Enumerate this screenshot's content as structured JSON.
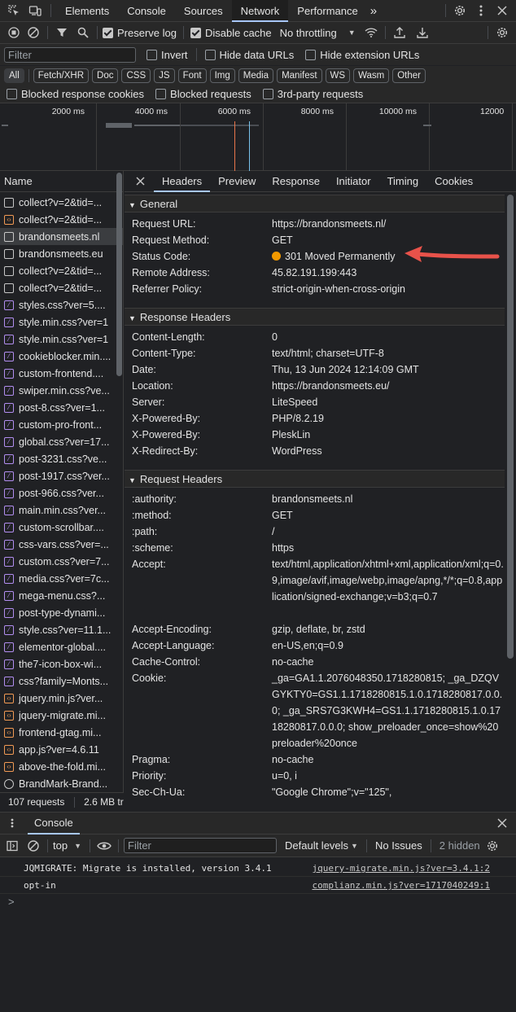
{
  "topbar": {
    "tabs": [
      "Elements",
      "Console",
      "Sources",
      "Network",
      "Performance"
    ],
    "active": "Network",
    "more": "»"
  },
  "toolbar": {
    "preserve_log": "Preserve log",
    "disable_cache": "Disable cache",
    "throttling": "No throttling"
  },
  "filter": {
    "placeholder": "Filter",
    "invert": "Invert",
    "hide_data_urls": "Hide data URLs",
    "hide_ext_urls": "Hide extension URLs"
  },
  "types": [
    "All",
    "Fetch/XHR",
    "Doc",
    "CSS",
    "JS",
    "Font",
    "Img",
    "Media",
    "Manifest",
    "WS",
    "Wasm",
    "Other"
  ],
  "blocked": {
    "blocked_cookies": "Blocked response cookies",
    "blocked_requests": "Blocked requests",
    "third_party": "3rd-party requests"
  },
  "overview": {
    "ticks": [
      "2000 ms",
      "4000 ms",
      "6000 ms",
      "8000 ms",
      "10000 ms",
      "12000"
    ]
  },
  "list": {
    "header": "Name",
    "items": [
      {
        "name": "collect?v=2&tid=...",
        "type": "doc"
      },
      {
        "name": "collect?v=2&tid=...",
        "type": "fetch"
      },
      {
        "name": "brandonsmeets.nl",
        "type": "doc",
        "selected": true
      },
      {
        "name": "brandonsmeets.eu",
        "type": "doc"
      },
      {
        "name": "collect?v=2&tid=...",
        "type": "doc"
      },
      {
        "name": "collect?v=2&tid=...",
        "type": "doc"
      },
      {
        "name": "styles.css?ver=5....",
        "type": "css"
      },
      {
        "name": "style.min.css?ver=1",
        "type": "css"
      },
      {
        "name": "style.min.css?ver=1",
        "type": "css"
      },
      {
        "name": "cookieblocker.min....",
        "type": "css"
      },
      {
        "name": "custom-frontend....",
        "type": "css"
      },
      {
        "name": "swiper.min.css?ve...",
        "type": "css"
      },
      {
        "name": "post-8.css?ver=1...",
        "type": "css"
      },
      {
        "name": "custom-pro-front...",
        "type": "css"
      },
      {
        "name": "global.css?ver=17...",
        "type": "css"
      },
      {
        "name": "post-3231.css?ve...",
        "type": "css"
      },
      {
        "name": "post-1917.css?ver...",
        "type": "css"
      },
      {
        "name": "post-966.css?ver...",
        "type": "css"
      },
      {
        "name": "main.min.css?ver...",
        "type": "css"
      },
      {
        "name": "custom-scrollbar....",
        "type": "css"
      },
      {
        "name": "css-vars.css?ver=...",
        "type": "css"
      },
      {
        "name": "custom.css?ver=7...",
        "type": "css"
      },
      {
        "name": "media.css?ver=7c...",
        "type": "css"
      },
      {
        "name": "mega-menu.css?...",
        "type": "css"
      },
      {
        "name": "post-type-dynami...",
        "type": "css"
      },
      {
        "name": "style.css?ver=11.1...",
        "type": "css"
      },
      {
        "name": "elementor-global....",
        "type": "css"
      },
      {
        "name": "the7-icon-box-wi...",
        "type": "css"
      },
      {
        "name": "css?family=Monts...",
        "type": "css"
      },
      {
        "name": "jquery.min.js?ver...",
        "type": "js"
      },
      {
        "name": "jquery-migrate.mi...",
        "type": "js"
      },
      {
        "name": "frontend-gtag.mi...",
        "type": "js"
      },
      {
        "name": "app.js?ver=4.6.11",
        "type": "js"
      },
      {
        "name": "above-the-fold.mi...",
        "type": "js"
      },
      {
        "name": "BrandMark-Brand...",
        "type": "img"
      }
    ],
    "footer_requests": "107 requests",
    "footer_size": "2.6 MB tr"
  },
  "detail": {
    "tabs": [
      "Headers",
      "Preview",
      "Response",
      "Initiator",
      "Timing",
      "Cookies"
    ],
    "active_tab": "Headers",
    "general": {
      "title": "General",
      "rows": [
        {
          "k": "Request URL:",
          "v": "https://brandonsmeets.nl/"
        },
        {
          "k": "Request Method:",
          "v": "GET"
        },
        {
          "k": "Status Code:",
          "v": "301 Moved Permanently"
        },
        {
          "k": "Remote Address:",
          "v": "45.82.191.199:443"
        },
        {
          "k": "Referrer Policy:",
          "v": "strict-origin-when-cross-origin"
        }
      ]
    },
    "response": {
      "title": "Response Headers",
      "rows": [
        {
          "k": "Content-Length:",
          "v": "0"
        },
        {
          "k": "Content-Type:",
          "v": "text/html; charset=UTF-8"
        },
        {
          "k": "Date:",
          "v": "Thu, 13 Jun 2024 12:14:09 GMT"
        },
        {
          "k": "Location:",
          "v": "https://brandonsmeets.eu/"
        },
        {
          "k": "Server:",
          "v": "LiteSpeed"
        },
        {
          "k": "X-Powered-By:",
          "v": "PHP/8.2.19"
        },
        {
          "k": "X-Powered-By:",
          "v": "PleskLin"
        },
        {
          "k": "X-Redirect-By:",
          "v": "WordPress"
        }
      ]
    },
    "request": {
      "title": "Request Headers",
      "rows": [
        {
          "k": ":authority:",
          "v": "brandonsmeets.nl"
        },
        {
          "k": ":method:",
          "v": "GET"
        },
        {
          "k": ":path:",
          "v": "/"
        },
        {
          "k": ":scheme:",
          "v": "https"
        },
        {
          "k": "Accept:",
          "v": "text/html,application/xhtml+xml,application/xml;q=0.9,image/avif,image/webp,image/apng,*/*;q=0.8,application/signed-exchange;v=b3;q=0.7"
        },
        {
          "k": "Accept-Encoding:",
          "v": "gzip, deflate, br, zstd"
        },
        {
          "k": "Accept-Language:",
          "v": "en-US,en;q=0.9"
        },
        {
          "k": "Cache-Control:",
          "v": "no-cache"
        },
        {
          "k": "Cookie:",
          "v": "_ga=GA1.1.2076048350.1718280815; _ga_DZQVGYKTY0=GS1.1.1718280815.1.0.1718280817.0.0.0; _ga_SRS7G3KWH4=GS1.1.1718280815.1.0.1718280817.0.0.0; show_preloader_once=show%20preloader%20once"
        },
        {
          "k": "Pragma:",
          "v": "no-cache"
        },
        {
          "k": "Priority:",
          "v": "u=0, i"
        },
        {
          "k": "Sec-Ch-Ua:",
          "v": "\"Google Chrome\";v=\"125\","
        }
      ]
    }
  },
  "console": {
    "title": "Console",
    "context": "top",
    "filter_placeholder": "Filter",
    "levels": "Default levels",
    "issues": "No Issues",
    "hidden": "2 hidden",
    "lines": [
      {
        "text": "JQMIGRATE: Migrate is installed, version 3.4.1",
        "source": "jquery-migrate.min.js?ver=3.4.1:2"
      },
      {
        "text": "opt-in",
        "source": "complianz.min.js?ver=1717040249:1"
      }
    ],
    "prompt": ">"
  },
  "colors": {
    "status_dot": "#f29900",
    "arrow": "#e8524a",
    "accent": "#a8c7fa"
  }
}
